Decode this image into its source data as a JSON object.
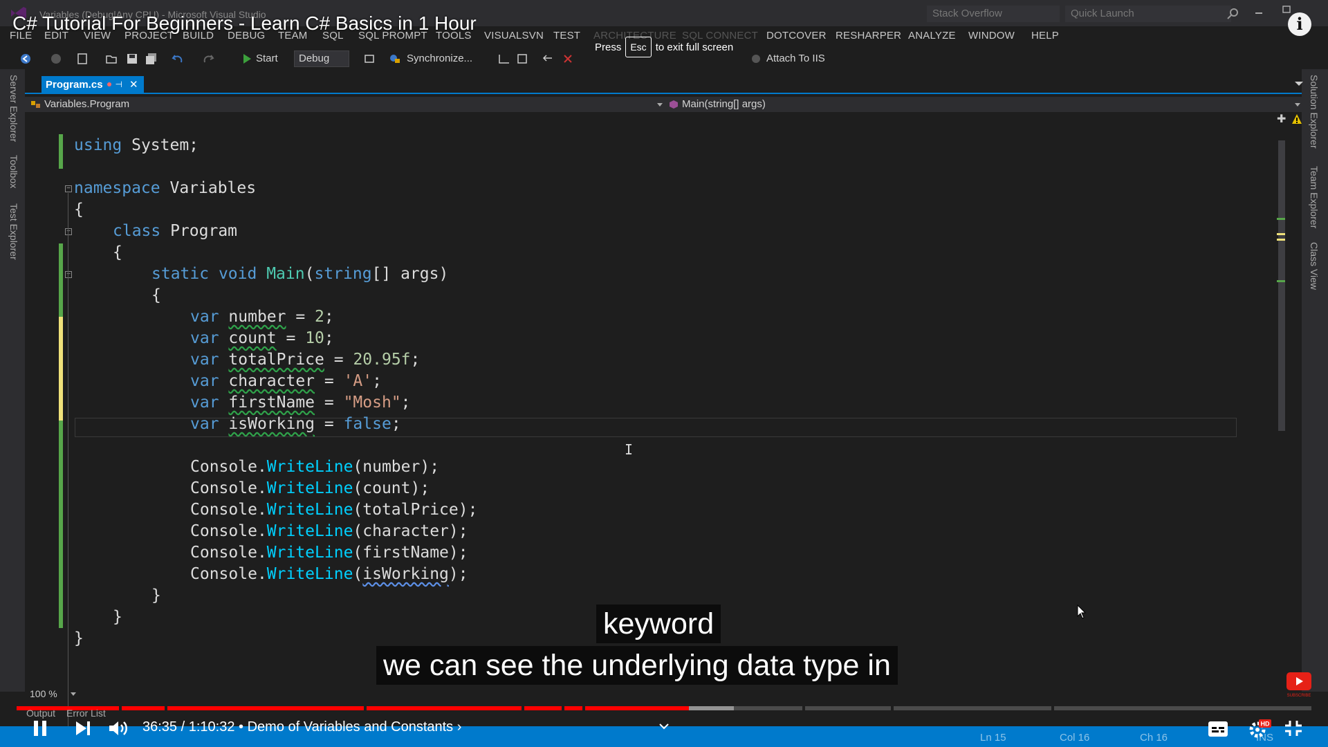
{
  "video": {
    "title": "C# Tutorial For Beginners - Learn C# Basics in 1 Hour",
    "time_current": "36:35",
    "time_total": "1:10:32",
    "chapter": "Demo of Variables and Constants",
    "progress_fraction": 0.519,
    "buffer_fraction": 0.554,
    "fullscreen_hint_pre": "Press",
    "fullscreen_hint_key": "Esc",
    "fullscreen_hint_post": "to exit full screen",
    "subtitle_line1": "keyword",
    "subtitle_line2": "we can see the underlying data type in",
    "hd_badge": "HD",
    "subscribe_label": "SUBSCRIBE"
  },
  "ide": {
    "window_title": "Variables (Debug|Any CPU) - Microsoft Visual Studio",
    "search_stackoverflow": "Stack Overflow",
    "quick_launch": "Quick Launch",
    "menu": [
      "FILE",
      "EDIT",
      "VIEW",
      "PROJECT",
      "BUILD",
      "DEBUG",
      "TEAM",
      "SQL",
      "SQL PROMPT",
      "TOOLS",
      "VISUALSVN",
      "TEST",
      "ARCHITECTURE",
      "SQL CONNECT",
      "DOTCOVER",
      "RESHARPER",
      "ANALYZE",
      "WINDOW",
      "HELP"
    ],
    "toolbar": {
      "start_label": "Start",
      "config": "Debug",
      "synchronize_label": "Synchronize...",
      "attach_label": "Attach To IIS"
    },
    "left_tabs": [
      "Server Explorer",
      "Toolbox",
      "Test Explorer"
    ],
    "right_tabs": [
      "Solution Explorer",
      "Team Explorer",
      "Class View"
    ],
    "doc_tab": "Program.cs",
    "nav_class": "Variables.Program",
    "nav_member": "Main(string[] args)",
    "zoom": "100 %",
    "bottom_tabs": [
      "Output",
      "Error List"
    ],
    "status": {
      "line": "Ln 15",
      "col": "Col 16",
      "ch": "Ch 16",
      "mode": "INS"
    },
    "accent_color": "#007acc"
  },
  "code": {
    "l1_kw": "using",
    "l1_rest": " System;",
    "l2_kw": "namespace",
    "l2_rest": " Variables",
    "brace_open": "{",
    "brace_close": "}",
    "l4_kw": "class",
    "l4_rest": " Program",
    "l6_static": "static",
    "l6_void": " void",
    "l6_main": " Main",
    "l6_paren": "(",
    "l6_string": "string",
    "l6_args": "[] args)",
    "var": "var",
    "v1_name": "number",
    "v1_eq": " = ",
    "v1_val": "2",
    "v1_end": ";",
    "v2_name": "count",
    "v2_eq": " = ",
    "v2_val": "10",
    "v2_end": ";",
    "v3_name": "totalPrice",
    "v3_eq": " = ",
    "v3_val": "20.95f",
    "v3_end": ";",
    "v4_name": "character",
    "v4_eq": " = ",
    "v4_val": "'A'",
    "v4_end": ";",
    "v5_name": "firstName",
    "v5_eq": " = ",
    "v5_val": "\"Mosh\"",
    "v5_end": ";",
    "v6_name": "isWorking",
    "v6_eq": " = ",
    "v6_val": "false",
    "v6_end": ";",
    "console": "Console",
    "dot": ".",
    "writeline": "WriteLine",
    "w1_arg": "(number);",
    "w2_arg": "(count);",
    "w3_arg": "(totalPrice);",
    "w4_arg": "(character);",
    "w5_arg": "(firstName);",
    "w6_open": "(",
    "w6_arg": "isWorking",
    "w6_close": ");"
  }
}
